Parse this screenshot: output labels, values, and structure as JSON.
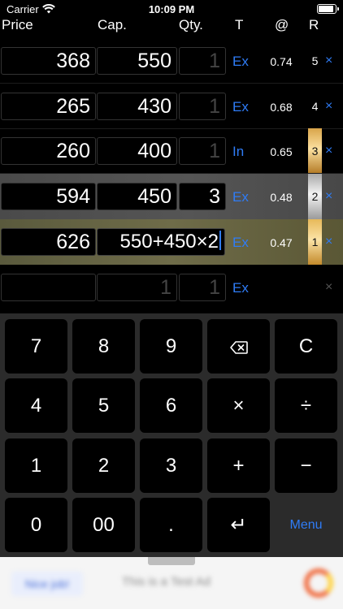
{
  "status_bar": {
    "carrier": "Carrier",
    "time": "10:09 PM",
    "battery_level": 0.95
  },
  "header": {
    "price": "Price",
    "cap": "Cap.",
    "qty": "Qty.",
    "type": "T",
    "at": "@",
    "rank": "R"
  },
  "rows": [
    {
      "price": "368",
      "cap": "550",
      "qty": "1",
      "type": "Ex",
      "rate": "0.74",
      "rank": "5",
      "delete": "×"
    },
    {
      "price": "265",
      "cap": "430",
      "qty": "1",
      "type": "Ex",
      "rate": "0.68",
      "rank": "4",
      "delete": "×"
    },
    {
      "price": "260",
      "cap": "400",
      "qty": "1",
      "type": "In",
      "rate": "0.65",
      "rank": "3",
      "delete": "×"
    },
    {
      "price": "594",
      "cap": "450",
      "qty": "3",
      "type": "Ex",
      "rate": "0.48",
      "rank": "2",
      "delete": "×"
    },
    {
      "price": "626",
      "cap": "550+450×2",
      "qty": "",
      "type": "Ex",
      "rate": "0.47",
      "rank": "1",
      "delete": "×"
    },
    {
      "price": "",
      "cap": "1",
      "qty": "1",
      "type": "Ex",
      "rate": "",
      "rank": "",
      "delete": "×"
    }
  ],
  "keypad": {
    "k7": "7",
    "k8": "8",
    "k9": "9",
    "backspace": "⌫",
    "clear": "C",
    "k4": "4",
    "k5": "5",
    "k6": "6",
    "multiply": "×",
    "divide": "÷",
    "k1": "1",
    "k2": "2",
    "k3": "3",
    "plus": "+",
    "minus": "−",
    "k0": "0",
    "k00": "00",
    "dot": ".",
    "enter": "↵",
    "menu": "Menu"
  },
  "ad": {
    "button": "Nice job!",
    "text": "This is a Test Ad"
  },
  "colors": {
    "accent": "#2f7cf6",
    "background": "#000000",
    "keypad_bg": "#2b2b2b"
  }
}
